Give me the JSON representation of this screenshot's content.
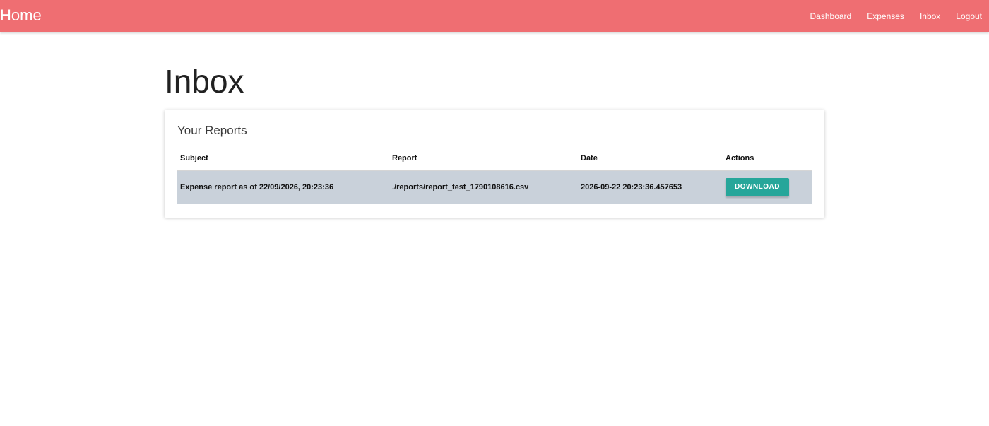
{
  "navbar": {
    "brand": "Home",
    "links": [
      {
        "label": "Dashboard"
      },
      {
        "label": "Expenses"
      },
      {
        "label": "Inbox"
      },
      {
        "label": "Logout"
      }
    ],
    "background_color": "#ef6e72"
  },
  "page": {
    "title": "Inbox"
  },
  "reports": {
    "title": "Your Reports",
    "headers": {
      "subject": "Subject",
      "report": "Report",
      "date": "Date",
      "actions": "Actions"
    },
    "rows": [
      {
        "subject": "Expense report as of 22/09/2026, 20:23:36",
        "report": "./reports/report_test_1790108616.csv",
        "date": "2026-09-22 20:23:36.457653",
        "action_label": "Download"
      }
    ],
    "row_highlight_color": "#c9d1da",
    "button_color": "#26a69a"
  }
}
